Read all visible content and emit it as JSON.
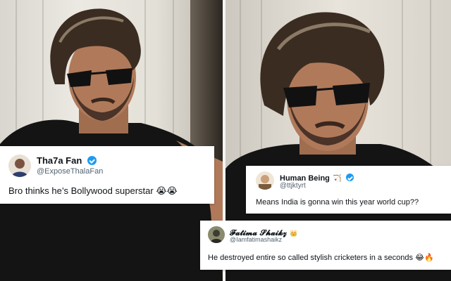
{
  "tweets": [
    {
      "name": "Tha7a Fan",
      "handle": "@ExposeThalaFan",
      "text": "Bro thinks he’s Bollywood superstar",
      "emoji": "😭😭"
    },
    {
      "name": "Human Being",
      "name_emoji": "🏹",
      "handle": "@ttjktyrt",
      "text": "Means India is gonna win this year world cup??"
    },
    {
      "name": "𝓕𝓪𝓽𝓲𝓶𝓪 𝓢𝓱𝓪𝓲𝓴𝔃",
      "name_emoji": "👑",
      "handle": "@Iamfatimashaikz",
      "text": "He destroyed entire so called stylish cricketers in a seconds",
      "emoji": "😂🔥"
    }
  ],
  "colors": {
    "verified": "#1d9bf0",
    "handle": "#536471",
    "shirt": "#141414"
  }
}
